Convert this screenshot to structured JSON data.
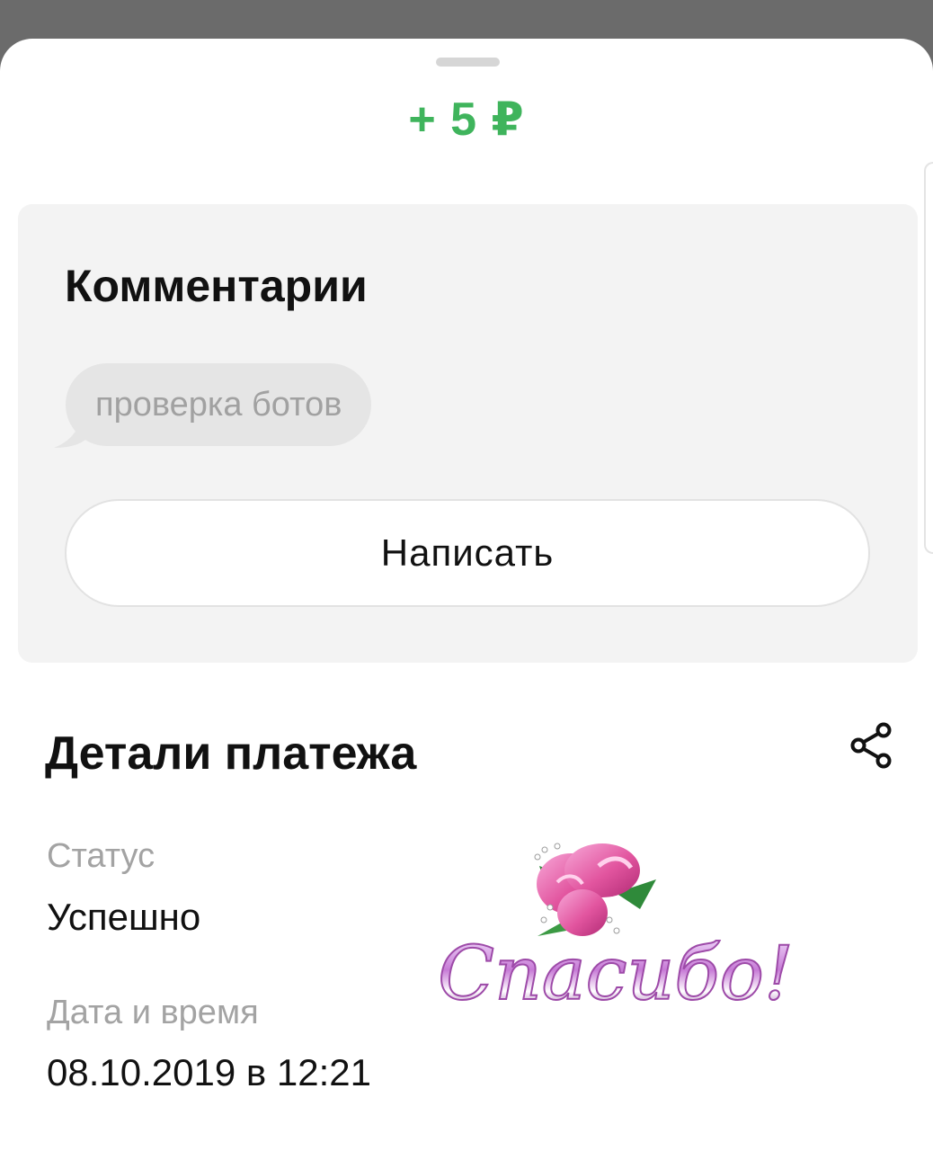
{
  "payment": {
    "amount": "+ 5 ₽"
  },
  "comments": {
    "title": "Комментарии",
    "items": [
      {
        "text": "проверка ботов"
      }
    ],
    "write_button_label": "Написать"
  },
  "details": {
    "title": "Детали платежа",
    "share_icon": "share-icon",
    "fields": [
      {
        "label": "Статус",
        "value": "Успешно"
      },
      {
        "label": "Дата и время",
        "value": "08.10.2019 в 12:21"
      }
    ]
  },
  "sticker": {
    "text": "Спасибо!",
    "icon": "rose-bouquet-sticker"
  },
  "colors": {
    "amount": "#3fb45c",
    "card_background": "#f3f3f3",
    "bubble_background": "#e5e5e5",
    "label_text": "#a3a3a3",
    "primary_text": "#111111"
  }
}
